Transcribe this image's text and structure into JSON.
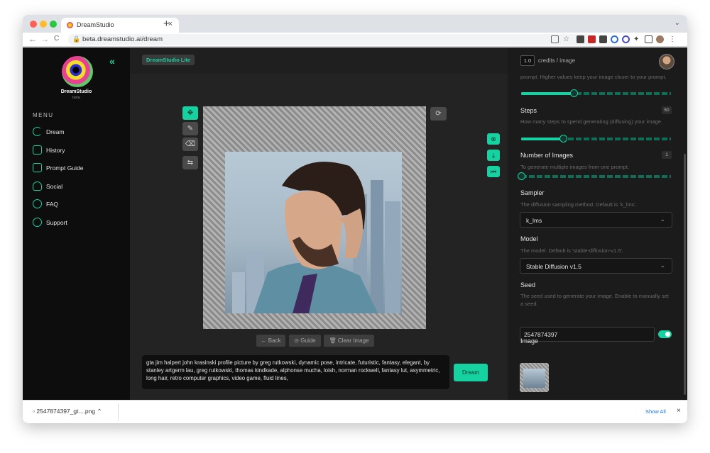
{
  "browser": {
    "tab_title": "DreamStudio",
    "tab_close": "×",
    "new_tab": "+",
    "url": "beta.dreamstudio.ai/dream",
    "back": "←",
    "forward": "→",
    "reload": "C"
  },
  "sidebar": {
    "brand": "DreamStudio",
    "beta": "beta",
    "collapse_glyph": "«",
    "menu_heading": "MENU",
    "items": [
      {
        "label": "Dream",
        "icon": "moon-icon"
      },
      {
        "label": "History",
        "icon": "image-icon"
      },
      {
        "label": "Prompt Guide",
        "icon": "chat-icon"
      },
      {
        "label": "Social",
        "icon": "people-icon"
      },
      {
        "label": "FAQ",
        "icon": "question-icon"
      },
      {
        "label": "Support",
        "icon": "discord-icon"
      }
    ]
  },
  "topbar": {
    "lite_label": "DreamStudio Lite"
  },
  "canvas": {
    "tools": [
      "move-tool-icon",
      "brush-icon",
      "eraser-icon",
      "swap-icon"
    ],
    "back_label": "← Back",
    "guide_label": "⊙ Guide",
    "clear_label": "🗑 Clear Image",
    "prompt": "gta jim halpert john krasinski profile picture by greg rutkowski, dynamic pose, intricate, futuristic, fantasy, elegant, by stanley artgerm lau, greg rutkowski, thomas kindkade, alphonse mucha, loish, norman rockwell, fantasy lut, asymmetric, long hair, retro computer graphics, video game, fluid lines,",
    "dream_label": "Dream"
  },
  "settings": {
    "credits_value": "1.0",
    "credits_label": "credits / image",
    "cfg_desc": "prompt. Higher values keep your image closer to your prompt.",
    "cfg_level": 0.35,
    "steps_label": "Steps",
    "steps_value": "50",
    "steps_desc": "How many steps to spend generating (diffusing) your image.",
    "steps_level": 0.28,
    "num_images_label": "Number of Images",
    "num_images_value": "1",
    "num_images_desc": "To generate multiple images from one prompt.",
    "num_images_level": 0.0,
    "sampler_label": "Sampler",
    "sampler_desc": "The diffusion sampling method. Default is 'k_lms'.",
    "sampler_value": "k_lms",
    "model_label": "Model",
    "model_desc": "The model. Default is 'stable-diffusion-v1.5'.",
    "model_value": "Stable Diffusion v1.5",
    "seed_label": "Seed",
    "seed_desc": "The seed used to generate your image. Enable to manually set a seed.",
    "seed_value": "2547874397",
    "image_label": "Image"
  },
  "downloads": {
    "file": "2547874397_gt....png",
    "show_all": "Show All",
    "close": "×"
  },
  "colors": {
    "accent": "#16d1a0",
    "sidebar_bg": "#0d0d0d",
    "panel_bg": "#1b1b1b"
  }
}
